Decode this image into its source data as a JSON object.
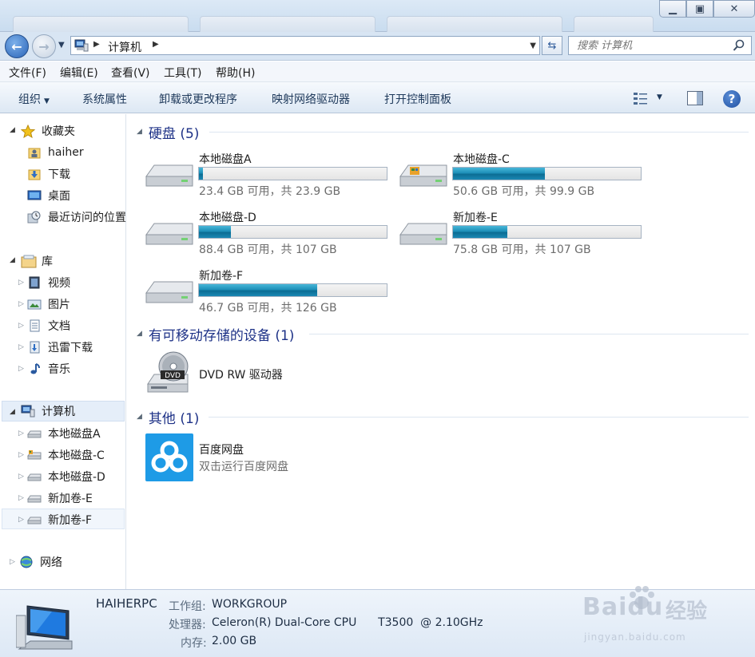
{
  "window": {
    "min_icon": "minimize-icon",
    "max_icon": "maximize-icon",
    "close_icon": "close-icon"
  },
  "address": {
    "segments": [
      "计算机"
    ]
  },
  "search": {
    "placeholder": "搜索 计算机"
  },
  "menu": [
    "文件(F)",
    "编辑(E)",
    "查看(V)",
    "工具(T)",
    "帮助(H)"
  ],
  "toolbar": {
    "organize": "组织",
    "system_properties": "系统属性",
    "uninstall": "卸载或更改程序",
    "map_drive": "映射网络驱动器",
    "control_panel": "打开控制面板"
  },
  "sidebar": {
    "favorites": {
      "label": "收藏夹",
      "items": [
        "haiher",
        "下载",
        "桌面",
        "最近访问的位置"
      ]
    },
    "libraries": {
      "label": "库",
      "items": [
        "视频",
        "图片",
        "文档",
        "迅雷下载",
        "音乐"
      ]
    },
    "computer": {
      "label": "计算机",
      "items": [
        "本地磁盘A",
        "本地磁盘-C",
        "本地磁盘-D",
        "新加卷-E",
        "新加卷-F"
      ]
    },
    "network": {
      "label": "网络"
    }
  },
  "groups": {
    "hard_disks": {
      "title": "硬盘 (5)"
    },
    "removable": {
      "title": "有可移动存储的设备 (1)"
    },
    "other": {
      "title": "其他 (1)"
    }
  },
  "drives": [
    {
      "name": "本地磁盘A",
      "free": "23.4 GB 可用，共 23.9 GB",
      "used_fraction": 0.02
    },
    {
      "name": "本地磁盘-C",
      "free": "50.6 GB 可用，共 99.9 GB",
      "used_fraction": 0.49
    },
    {
      "name": "本地磁盘-D",
      "free": "88.4 GB 可用，共 107 GB",
      "used_fraction": 0.17
    },
    {
      "name": "新加卷-E",
      "free": "75.8 GB 可用，共 107 GB",
      "used_fraction": 0.29
    },
    {
      "name": "新加卷-F",
      "free": "46.7 GB 可用，共 126 GB",
      "used_fraction": 0.63
    }
  ],
  "removable_devices": [
    {
      "name": "DVD RW 驱动器",
      "badge": "DVD"
    }
  ],
  "other_items": [
    {
      "name": "百度网盘",
      "desc": "双击运行百度网盘"
    }
  ],
  "details": {
    "pc_name": "HAIHERPC",
    "workgroup_label": "工作组:",
    "workgroup": "WORKGROUP",
    "cpu_label": "处理器:",
    "cpu": "Celeron(R) Dual-Core CPU      T3500  @ 2.10GHz",
    "ram_label": "内存:",
    "ram": "2.00 GB"
  },
  "watermark": {
    "brand": "Baidu",
    "cn": "经验",
    "url": "jingyan.baidu.com"
  },
  "colors": {
    "accent": "#1e3287",
    "progress": "#1d8fb8",
    "selection": "#e5eef9"
  }
}
